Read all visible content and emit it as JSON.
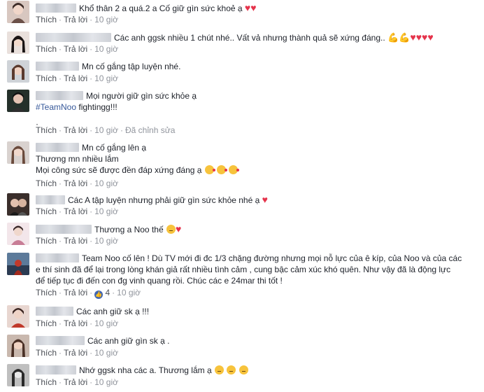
{
  "actions": {
    "like": "Thích",
    "reply": "Trả lời",
    "edited": "Đã chỉnh sửa"
  },
  "comments": [
    {
      "lines": [
        "Khổ thân 2 a quá.2 a Cố giữ gìn sức khoẻ ạ"
      ],
      "time": "10 giờ",
      "emoji": [
        "heart",
        "heart"
      ]
    },
    {
      "lines": [
        "Các anh ggsk nhiều 1 chút nhé.. Vất vả nhưng thành quả sẽ xứng đáng.."
      ],
      "time": "10 giờ",
      "emoji": [
        "muscle",
        "muscle",
        "heart",
        "heart",
        "heart",
        "heart"
      ]
    },
    {
      "lines": [
        "Mn cố gắng tập luyện nhé."
      ],
      "time": "10 giờ"
    },
    {
      "lines": [
        "Mọi người giữ gìn sức khỏe ạ"
      ],
      "hashtag": "#TeamNoo",
      "hashtag_rest": " fightingg!!!",
      "time": "10 giờ",
      "edited": true
    },
    {
      "lines": [
        "Mn cố gắng lên ạ",
        "Thương mn nhiều lắm",
        "Mọi công sức sẽ được đền đáp xứng đáng ạ"
      ],
      "time": "10 giờ",
      "emoji": [
        "kiss",
        "kiss",
        "kiss"
      ]
    },
    {
      "lines": [
        "Các A tập luyện nhưng phải giữ gìn sức khỏe nhé ạ"
      ],
      "time": "10 giờ",
      "emoji": [
        "heart"
      ]
    },
    {
      "lines": [
        "Thương a Noo thế"
      ],
      "time": "10 giờ",
      "emoji": [
        "sad",
        "heart"
      ]
    },
    {
      "lines": [
        "Team Noo cố lên ! Dù TV mới đi đc 1/3 chặng đường nhưng mọi nỗ lực của ê kíp, của Noo và của các",
        "e thí sinh đã để lại trong lòng khán giả rất nhiều tình cảm , cung bậc cảm xúc khó quên. Như vậy đã là động lực",
        "để tiếp tục đi đến con đg vinh quang rồi. Chúc các e 24mar thi tốt !"
      ],
      "time": "10 giờ",
      "likes": "4"
    },
    {
      "lines": [
        "Các anh giữ sk ạ !!!"
      ],
      "time": "10 giờ"
    },
    {
      "lines": [
        "Các anh giữ gìn sk ạ ."
      ],
      "time": "10 giờ"
    },
    {
      "lines": [
        "Nhớ ggsk nha các a. Thương lắm ạ"
      ],
      "time": "10 giờ",
      "emoji": [
        "sad",
        "sad",
        "sad"
      ]
    }
  ],
  "colors": {
    "link": "#365899",
    "meta": "#90949c",
    "like_blue": "#4267b2",
    "heart": "#e5334b"
  }
}
